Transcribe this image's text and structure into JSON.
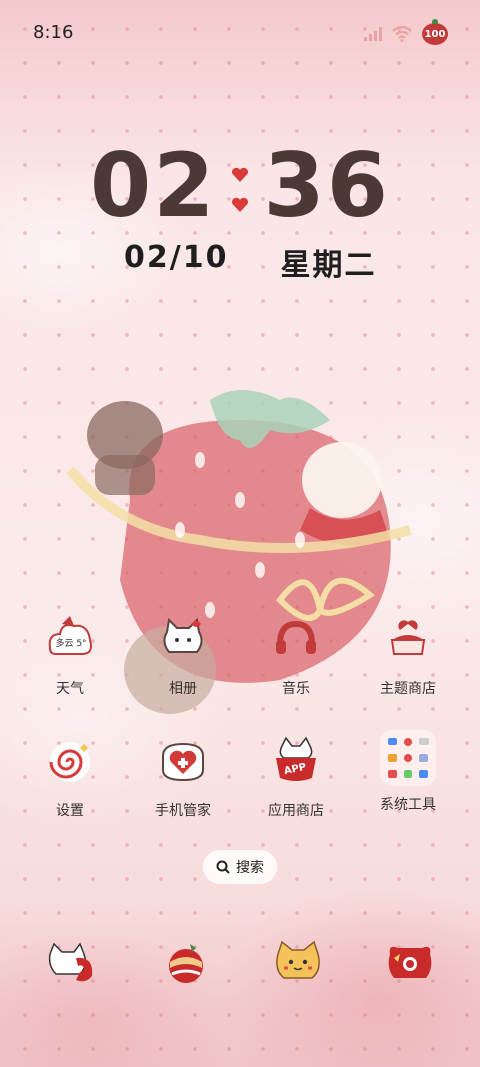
{
  "status_bar": {
    "time": "8:16",
    "battery": "100"
  },
  "clock": {
    "hours": "02",
    "minutes": "36"
  },
  "date": {
    "day": "02/10",
    "weekday": "星期二"
  },
  "apps": [
    {
      "label": "天气",
      "widget_text": "多云 5°"
    },
    {
      "label": "相册"
    },
    {
      "label": "音乐"
    },
    {
      "label": "主题商店"
    },
    {
      "label": "设置"
    },
    {
      "label": "手机管家"
    },
    {
      "label": "应用商店",
      "badge_text": "APP"
    },
    {
      "label": "系统工具"
    }
  ],
  "search": {
    "label": "搜索"
  },
  "dock": [
    {
      "icon": "phone-cat-icon"
    },
    {
      "icon": "browser-globe-icon"
    },
    {
      "icon": "messages-cat-icon"
    },
    {
      "icon": "camera-bear-icon"
    }
  ],
  "colors": {
    "accent": "#c23a3a",
    "clock": "#4a3934",
    "background": "#f7dede"
  }
}
